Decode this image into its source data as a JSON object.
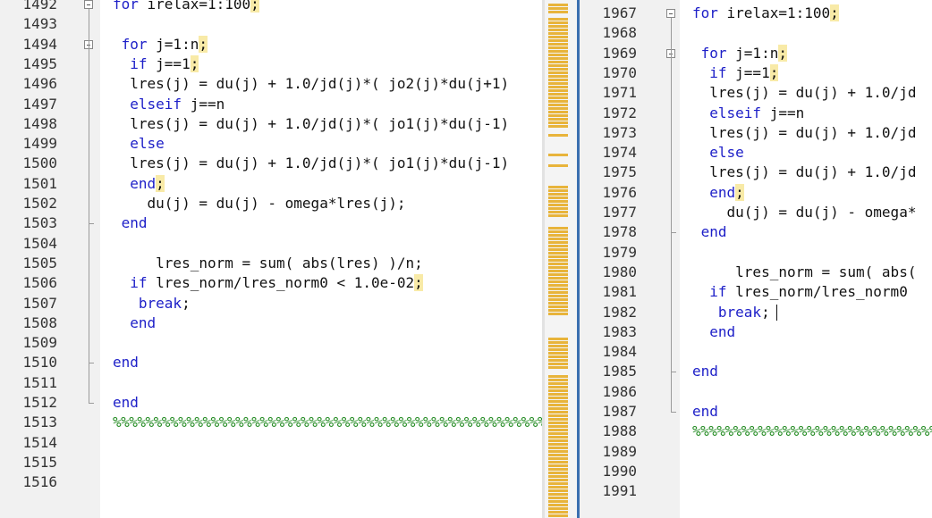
{
  "left": {
    "line_numbers": [
      "1492",
      "1493",
      "1494",
      "1495",
      "1496",
      "1497",
      "1498",
      "1499",
      "1500",
      "1501",
      "1502",
      "1503",
      "1504",
      "1505",
      "1506",
      "1507",
      "1508",
      "1509",
      "1510",
      "1511",
      "1512",
      "1513",
      "1514",
      "1515",
      "1516"
    ],
    "code": [
      {
        "parts": [
          {
            "t": "for",
            "c": "kw"
          },
          {
            "t": " irelax=1:100",
            "c": "op"
          },
          {
            "t": ";",
            "c": "mark"
          }
        ]
      },
      {
        "parts": []
      },
      {
        "parts": [
          {
            "t": " for",
            "c": "kw"
          },
          {
            "t": " j=1:n",
            "c": "op"
          },
          {
            "t": ";",
            "c": "mark"
          }
        ]
      },
      {
        "parts": [
          {
            "t": "  if",
            "c": "kw"
          },
          {
            "t": " j==1",
            "c": "op"
          },
          {
            "t": ";",
            "c": "mark"
          }
        ]
      },
      {
        "parts": [
          {
            "t": "  lres(j) = du(j) + 1.0/jd(j)*( jo2(j)*du(j+1)",
            "c": "op"
          }
        ]
      },
      {
        "parts": [
          {
            "t": "  elseif",
            "c": "kw"
          },
          {
            "t": " j==n",
            "c": "op"
          }
        ]
      },
      {
        "parts": [
          {
            "t": "  lres(j) = du(j) + 1.0/jd(j)*( jo1(j)*du(j-1)",
            "c": "op"
          }
        ]
      },
      {
        "parts": [
          {
            "t": "  else",
            "c": "kw"
          }
        ]
      },
      {
        "parts": [
          {
            "t": "  lres(j) = du(j) + 1.0/jd(j)*( jo1(j)*du(j-1)",
            "c": "op"
          }
        ]
      },
      {
        "parts": [
          {
            "t": "  end",
            "c": "kw"
          },
          {
            "t": ";",
            "c": "mark"
          }
        ]
      },
      {
        "parts": [
          {
            "t": "    du(j) = du(j) - omega*lres(j);",
            "c": "op"
          }
        ]
      },
      {
        "parts": [
          {
            "t": " end",
            "c": "kw"
          }
        ]
      },
      {
        "parts": []
      },
      {
        "parts": [
          {
            "t": "     lres_norm = sum( abs(lres) )/n;",
            "c": "op"
          }
        ]
      },
      {
        "parts": [
          {
            "t": "  if",
            "c": "kw"
          },
          {
            "t": " lres_norm/lres_norm0 < 1.0e-02",
            "c": "op"
          },
          {
            "t": ";",
            "c": "mark"
          }
        ]
      },
      {
        "parts": [
          {
            "t": "   break",
            "c": "kw"
          },
          {
            "t": ";",
            "c": "op"
          }
        ]
      },
      {
        "parts": [
          {
            "t": "  end",
            "c": "kw"
          }
        ]
      },
      {
        "parts": []
      },
      {
        "parts": [
          {
            "t": "end",
            "c": "kw"
          }
        ]
      },
      {
        "parts": []
      },
      {
        "parts": [
          {
            "t": "end",
            "c": "kw"
          }
        ]
      },
      {
        "parts": [
          {
            "t": "%%%%%%%%%%%%%%%%%%%%%%%%%%%%%%%%%%%%%%%%%%%%%%%%%%%%%%%%%%%%%",
            "c": "comment"
          }
        ]
      },
      {
        "parts": []
      },
      {
        "parts": []
      },
      {
        "parts": []
      }
    ]
  },
  "right": {
    "line_numbers": [
      "1967",
      "1968",
      "1969",
      "1970",
      "1971",
      "1972",
      "1973",
      "1974",
      "1975",
      "1976",
      "1977",
      "1978",
      "1979",
      "1980",
      "1981",
      "1982",
      "1983",
      "1984",
      "1985",
      "1986",
      "1987",
      "1988",
      "1989",
      "1990",
      "1991"
    ],
    "code": [
      {
        "parts": [
          {
            "t": "for",
            "c": "kw"
          },
          {
            "t": " irelax=1:100",
            "c": "op"
          },
          {
            "t": ";",
            "c": "mark"
          }
        ]
      },
      {
        "parts": []
      },
      {
        "parts": [
          {
            "t": " for",
            "c": "kw"
          },
          {
            "t": " j=1:n",
            "c": "op"
          },
          {
            "t": ";",
            "c": "mark"
          }
        ]
      },
      {
        "parts": [
          {
            "t": "  if",
            "c": "kw"
          },
          {
            "t": " j==1",
            "c": "op"
          },
          {
            "t": ";",
            "c": "mark"
          }
        ]
      },
      {
        "parts": [
          {
            "t": "  lres(j) = du(j) + 1.0/jd",
            "c": "op"
          }
        ]
      },
      {
        "parts": [
          {
            "t": "  elseif",
            "c": "kw"
          },
          {
            "t": " j==n",
            "c": "op"
          }
        ]
      },
      {
        "parts": [
          {
            "t": "  lres(j) = du(j) + 1.0/jd",
            "c": "op"
          }
        ]
      },
      {
        "parts": [
          {
            "t": "  else",
            "c": "kw"
          }
        ]
      },
      {
        "parts": [
          {
            "t": "  lres(j) = du(j) + 1.0/jd",
            "c": "op"
          }
        ]
      },
      {
        "parts": [
          {
            "t": "  end",
            "c": "kw"
          },
          {
            "t": ";",
            "c": "mark"
          }
        ]
      },
      {
        "parts": [
          {
            "t": "    du(j) = du(j) - omega*",
            "c": "op"
          }
        ]
      },
      {
        "parts": [
          {
            "t": " end",
            "c": "kw"
          }
        ]
      },
      {
        "parts": []
      },
      {
        "parts": [
          {
            "t": "     lres_norm = sum( abs(",
            "c": "op"
          }
        ]
      },
      {
        "parts": [
          {
            "t": "  if",
            "c": "kw"
          },
          {
            "t": " lres_norm/lres_norm0",
            "c": "op"
          }
        ]
      },
      {
        "parts": [
          {
            "t": "   break",
            "c": "kw"
          },
          {
            "t": ";",
            "c": "op"
          }
        ]
      },
      {
        "parts": [
          {
            "t": "  end",
            "c": "kw"
          }
        ]
      },
      {
        "parts": []
      },
      {
        "parts": [
          {
            "t": "end",
            "c": "kw"
          }
        ]
      },
      {
        "parts": []
      },
      {
        "parts": [
          {
            "t": "end",
            "c": "kw"
          }
        ]
      },
      {
        "parts": [
          {
            "t": "%%%%%%%%%%%%%%%%%%%%%%%%%%%%%%%%%%%%%",
            "c": "comment"
          }
        ]
      },
      {
        "parts": []
      },
      {
        "parts": []
      },
      {
        "parts": []
      }
    ]
  },
  "colors": {
    "keyword": "#1e20c8",
    "comment": "#238b22",
    "semicolon_highlight": "#f8eaa7",
    "change_marker": "#e8b43b",
    "active_divider": "#3a6fb0"
  }
}
